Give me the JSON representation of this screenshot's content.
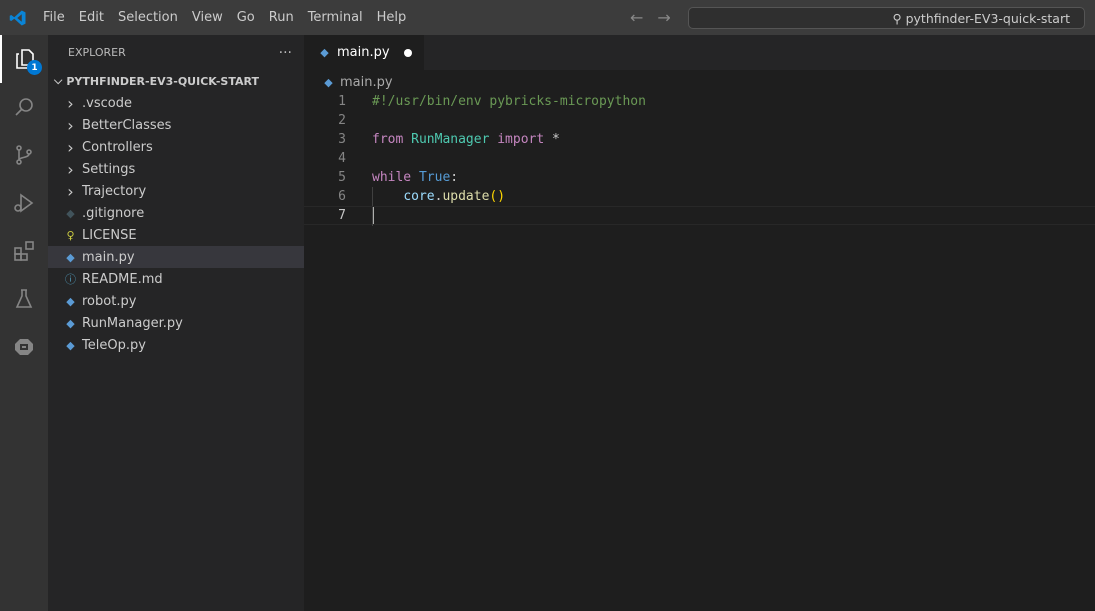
{
  "menu": [
    "File",
    "Edit",
    "Selection",
    "View",
    "Go",
    "Run",
    "Terminal",
    "Help"
  ],
  "search": {
    "text": "pythfinder-EV3-quick-start"
  },
  "activity": {
    "badge": "1",
    "items": [
      "explorer-icon",
      "search-icon",
      "source-control-icon",
      "run-debug-icon",
      "extensions-icon",
      "testing-icon",
      "ev3-device-icon"
    ]
  },
  "sidebar": {
    "title": "EXPLORER",
    "more": "···",
    "folder": "PYTHFINDER-EV3-QUICK-START",
    "items": [
      {
        "label": ".vscode",
        "type": "folder"
      },
      {
        "label": "BetterClasses",
        "type": "folder"
      },
      {
        "label": "Controllers",
        "type": "folder"
      },
      {
        "label": "Settings",
        "type": "folder"
      },
      {
        "label": "Trajectory",
        "type": "folder"
      },
      {
        "label": ".gitignore",
        "type": "git"
      },
      {
        "label": "LICENSE",
        "type": "license"
      },
      {
        "label": "main.py",
        "type": "python",
        "selected": true
      },
      {
        "label": "README.md",
        "type": "info"
      },
      {
        "label": "robot.py",
        "type": "python"
      },
      {
        "label": "RunManager.py",
        "type": "python"
      },
      {
        "label": "TeleOp.py",
        "type": "python"
      }
    ]
  },
  "tab": {
    "label": "main.py",
    "modified": true
  },
  "breadcrumb": "main.py",
  "code": {
    "lines": [
      [
        [
          "cm",
          "#!/usr/bin/env pybricks-micropython"
        ]
      ],
      [],
      [
        [
          "kw",
          "from"
        ],
        [
          "",
          ""
        ],
        [
          "cls",
          " RunManager"
        ],
        [
          "kw",
          " import"
        ],
        [
          "",
          " *"
        ]
      ],
      [],
      [
        [
          "kw",
          "while"
        ],
        [
          "bl",
          " True"
        ],
        [
          "",
          ":"
        ]
      ],
      [
        [
          "",
          "    "
        ],
        [
          "var",
          "core"
        ],
        [
          "",
          "."
        ],
        [
          "fn",
          "update"
        ],
        [
          "br",
          "()"
        ]
      ],
      []
    ],
    "current_line": 7
  },
  "colors": {
    "accent": "#0078d4",
    "titlebar": "#3c3c3c",
    "sidebar": "#252526",
    "editor": "#1e1e1e"
  }
}
